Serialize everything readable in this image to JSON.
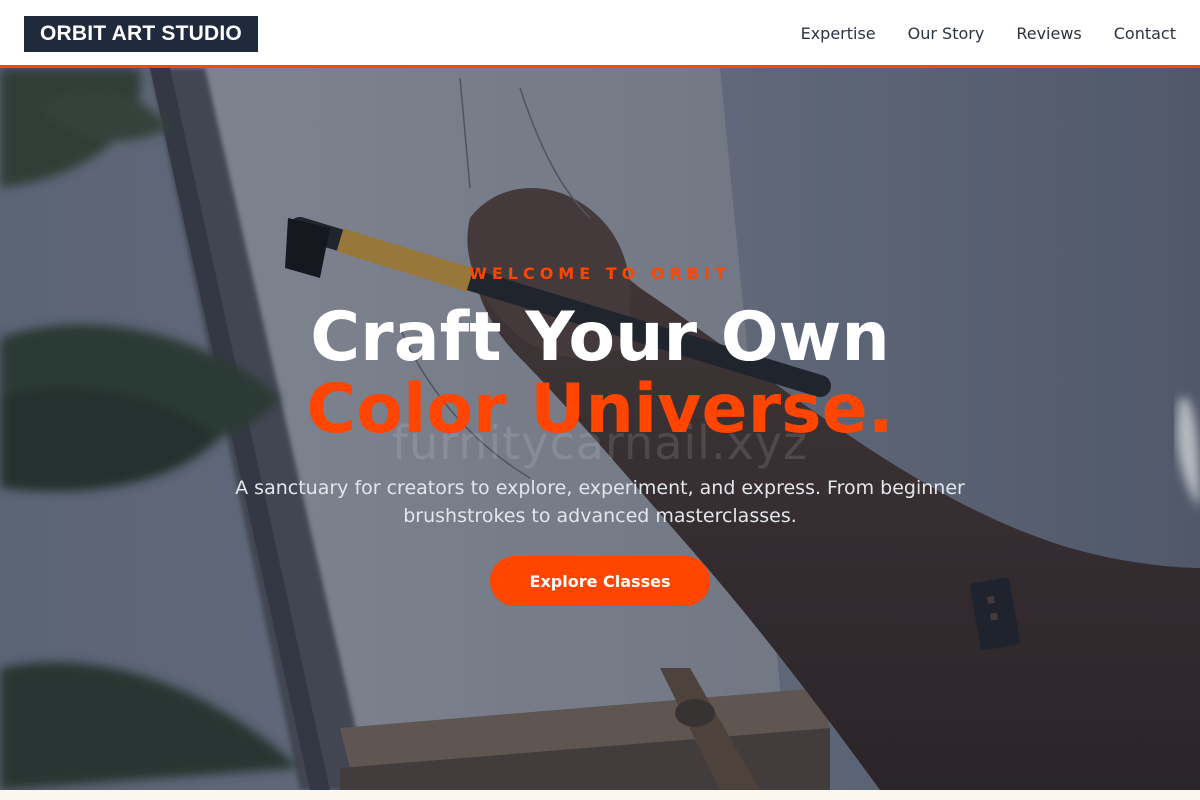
{
  "brand": {
    "name": "ORBIT ART STUDIO"
  },
  "nav": {
    "items": [
      {
        "label": "Expertise"
      },
      {
        "label": "Our Story"
      },
      {
        "label": "Reviews"
      },
      {
        "label": "Contact"
      }
    ]
  },
  "hero": {
    "eyebrow": "WELCOME TO ORBIT",
    "title_line1": "Craft Your Own",
    "title_line2": "Color Universe.",
    "watermark": "furnitycarnail.xyz",
    "subtitle": "A sanctuary for creators to explore, experiment, and express. From beginner brushstrokes to advanced masterclasses.",
    "cta_label": "Explore Classes",
    "background_image": "artist-painting-canvas-on-easel"
  },
  "colors": {
    "accent": "#ff4500",
    "logo_bg": "#1f2a3c",
    "nav_text": "#2b3340",
    "page_bg": "#fdf6ee"
  }
}
